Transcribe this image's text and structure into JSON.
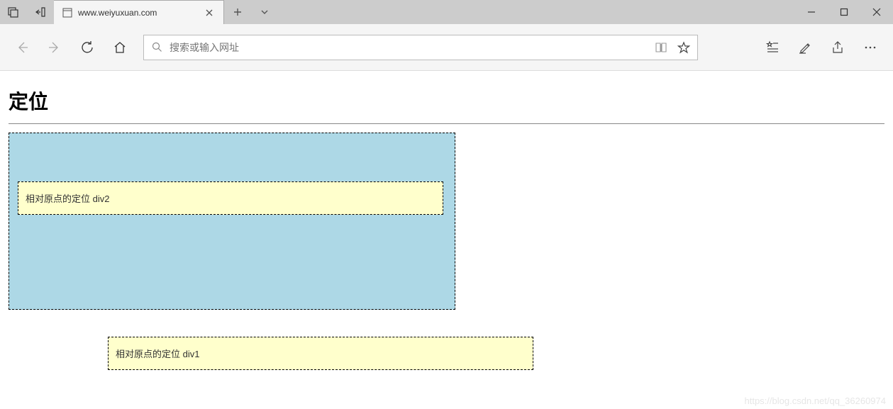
{
  "titlebar": {
    "tab_title": "www.weiyuxuan.com"
  },
  "toolbar": {
    "address_placeholder": "搜索或输入网址"
  },
  "content": {
    "heading": "定位",
    "div2_text": "相对原点的定位 div2",
    "div1_text": "相对原点的定位 div1"
  },
  "watermark": "https://blog.csdn.net/qq_36260974"
}
